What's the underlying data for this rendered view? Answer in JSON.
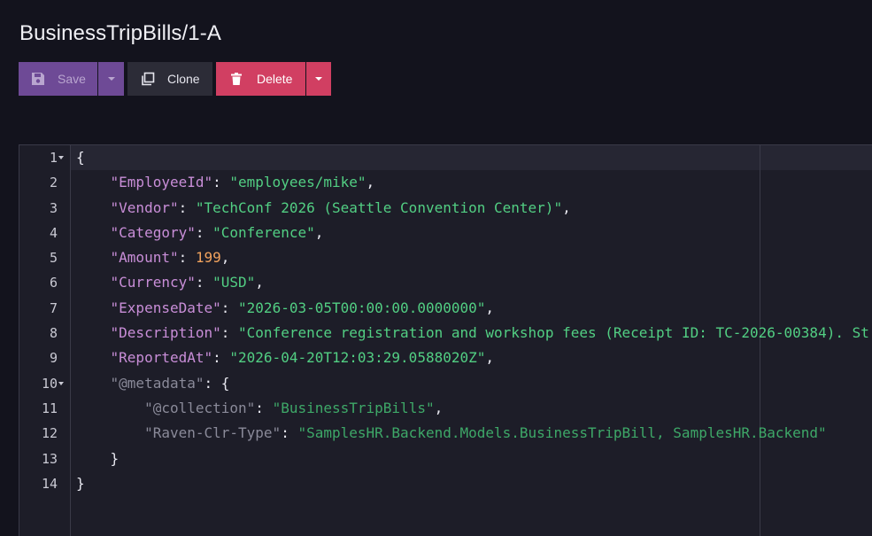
{
  "page": {
    "title": "BusinessTripBills/1-A"
  },
  "toolbar": {
    "save_label": "Save",
    "clone_label": "Clone",
    "delete_label": "Delete",
    "save_icon": "floppy-disk-icon",
    "clone_icon": "copy-icon",
    "delete_icon": "trash-icon",
    "colors": {
      "save": "#6e4a96",
      "clone": "#2c2c37",
      "delete": "#d13f62"
    }
  },
  "editor": {
    "line_numbers": [
      "1",
      "2",
      "3",
      "4",
      "5",
      "6",
      "7",
      "8",
      "9",
      "10",
      "11",
      "12",
      "13",
      "14"
    ],
    "lines": [
      {
        "indent": "",
        "open": "{"
      },
      {
        "indent": "    ",
        "key": "\"EmployeeId\"",
        "value": "\"employees/mike\"",
        "tail": ","
      },
      {
        "indent": "    ",
        "key": "\"Vendor\"",
        "value": "\"TechConf 2026 (Seattle Convention Center)\"",
        "tail": ","
      },
      {
        "indent": "    ",
        "key": "\"Category\"",
        "value": "\"Conference\"",
        "tail": ","
      },
      {
        "indent": "    ",
        "key": "\"Amount\"",
        "number": "199",
        "tail": ","
      },
      {
        "indent": "    ",
        "key": "\"Currency\"",
        "value": "\"USD\"",
        "tail": ","
      },
      {
        "indent": "    ",
        "key": "\"ExpenseDate\"",
        "value": "\"2026-03-05T00:00:00.0000000\"",
        "tail": ","
      },
      {
        "indent": "    ",
        "key": "\"Description\"",
        "value": "\"Conference registration and workshop fees (Receipt ID: TC-2026-00384). St",
        "tail": ""
      },
      {
        "indent": "    ",
        "key": "\"ReportedAt\"",
        "value": "\"2026-04-20T12:03:29.0588020Z\"",
        "tail": ","
      },
      {
        "indent": "    ",
        "meta_key": "\"@metadata\"",
        "open": "{"
      },
      {
        "indent": "        ",
        "meta_key": "\"@collection\"",
        "meta_value": "\"BusinessTripBills\"",
        "tail": ","
      },
      {
        "indent": "        ",
        "meta_key": "\"Raven-Clr-Type\"",
        "meta_value": "\"SamplesHR.Backend.Models.BusinessTripBill, SamplesHR.Backend\"",
        "tail": ""
      },
      {
        "indent": "    ",
        "close": "}"
      },
      {
        "indent": "",
        "close": "}"
      }
    ],
    "colors": {
      "key": "#c98ed8",
      "string": "#52cf83",
      "number": "#f2a35e",
      "metadata_key": "#8a8a99",
      "metadata_string": "#3ea868"
    }
  }
}
